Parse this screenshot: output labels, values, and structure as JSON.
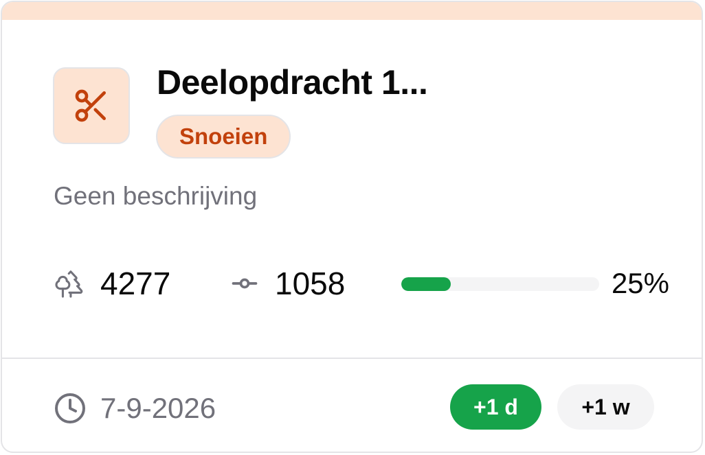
{
  "card": {
    "accent_color": "#fde3d2",
    "icon": "scissors-icon",
    "title": "Deelopdracht 1...",
    "category_badge": "Snoeien",
    "description": "Geen beschrijving"
  },
  "stats": {
    "trees": {
      "icon": "trees-icon",
      "value": "4277"
    },
    "commits": {
      "icon": "commit-icon",
      "value": "1058"
    },
    "progress": {
      "fraction": 0.25,
      "label": "25%",
      "color": "#16a34a"
    }
  },
  "footer": {
    "date_icon": "clock-icon",
    "date": "7-9-2026",
    "actions": {
      "day": "+1 d",
      "week": "+1 w"
    }
  }
}
